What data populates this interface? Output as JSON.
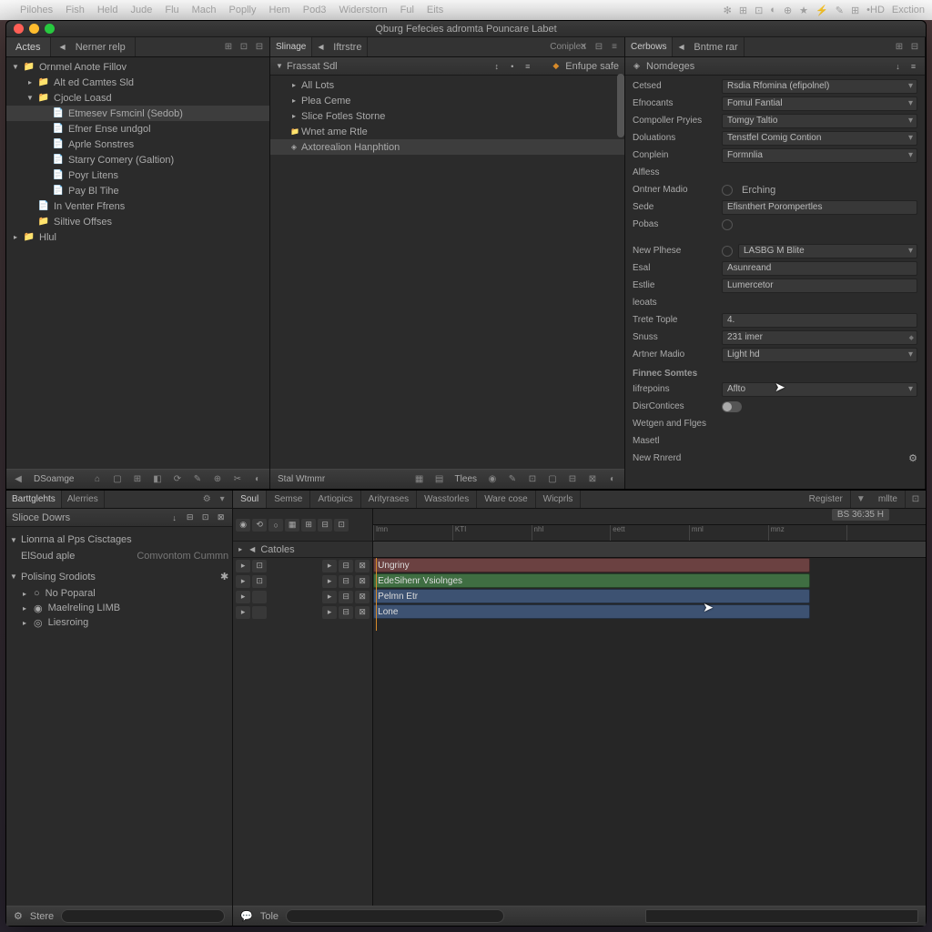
{
  "menubar": {
    "items": [
      "Pilohes",
      "Fish",
      "Held",
      "Jude",
      "Flu",
      "Mach",
      "Poplly",
      "Hem",
      "Pod3",
      "Widerstorn",
      "Ful",
      "Eits"
    ],
    "right": [
      "✻",
      "⊞",
      "⊡",
      "◐",
      "⊕",
      "★",
      "⚡",
      "✎",
      "⊞",
      "•HD",
      "Exction"
    ]
  },
  "window": {
    "title": "Qburg Fefecies adromta Pouncare Labet"
  },
  "left_tabs": [
    "Actes",
    "Nerner relp"
  ],
  "left_tab_icons": [
    "⊞",
    "⊡",
    "⊟"
  ],
  "mid_tabs": [
    "Slinage",
    "Iftrstre"
  ],
  "mid_head_label": "Enfupe safe",
  "right_tabs": [
    "Cerbows",
    "Bntme rar"
  ],
  "right_tab_icons": [
    "⊞",
    "⊟"
  ],
  "project_tree": [
    {
      "lvl": 0,
      "icon": "📁",
      "label": "Ornmel Anote Fillov",
      "open": true
    },
    {
      "lvl": 1,
      "icon": "📁",
      "label": "Alt ed Camtes Sld",
      "open": false
    },
    {
      "lvl": 1,
      "icon": "📁",
      "label": "Cjocle Loasd",
      "open": true
    },
    {
      "lvl": 2,
      "icon": "📄",
      "label": "Etmesev Fsmcinl (Sedob)",
      "sel": true
    },
    {
      "lvl": 2,
      "icon": "📄",
      "label": "Efner Ense undgol"
    },
    {
      "lvl": 2,
      "icon": "📄",
      "label": "Aprle Sonstres"
    },
    {
      "lvl": 2,
      "icon": "📄",
      "label": "Starry Comery (Galtion)"
    },
    {
      "lvl": 2,
      "icon": "📄",
      "label": "Poyr Litens"
    },
    {
      "lvl": 2,
      "icon": "📄",
      "label": "Pay Bl Tihe"
    },
    {
      "lvl": 1,
      "icon": "📄",
      "label": "In Venter Ffrens"
    },
    {
      "lvl": 1,
      "icon": "📁",
      "label": "Siltive Offses"
    },
    {
      "lvl": 0,
      "icon": "📁",
      "label": "Hlul",
      "open": false
    }
  ],
  "mid_panel": {
    "head": "Frassat Sdl",
    "rows": [
      {
        "icon": "▸",
        "label": "All Lots"
      },
      {
        "icon": "▸",
        "label": "Plea Ceme"
      },
      {
        "icon": "▸",
        "label": "Slice Fotles Storne"
      },
      {
        "icon": "📁",
        "label": "Wnet ame Rtle"
      },
      {
        "icon": "◈",
        "label": "Axtorealion Hanphtion",
        "sel": true
      }
    ]
  },
  "props_panel": {
    "head": "Nomdeges",
    "rows": [
      {
        "lbl": "Cetsed",
        "val": "Rsdia Rfomina (efipolnel)",
        "type": "dd"
      },
      {
        "lbl": "Efnocants",
        "val": "Fomul Fantial",
        "type": "dd"
      },
      {
        "lbl": "Compoller Pryies",
        "val": "Tomgy Taltio",
        "type": "dd"
      },
      {
        "lbl": "Doluations",
        "val": "Tenstfel Comig Contion",
        "type": "dd"
      },
      {
        "lbl": "Conplein",
        "val": "Formnlia",
        "type": "dd"
      },
      {
        "lbl": "Alfless",
        "val": "",
        "type": "none"
      },
      {
        "lbl": "Ontner Madio",
        "val": "Erching",
        "type": "radio"
      },
      {
        "lbl": "Sede",
        "val": "Efisnthert Porompertles",
        "type": "txt"
      },
      {
        "lbl": "Pobas",
        "val": "",
        "type": "radonly"
      }
    ],
    "rows2": [
      {
        "lbl": "New Plhese",
        "val": "LASBG M Blite",
        "type": "dd",
        "radio": true
      },
      {
        "lbl": "Esal",
        "val": "Asunreand",
        "type": "txt"
      },
      {
        "lbl": "Estlie",
        "val": "Lumercetor",
        "type": "txt"
      },
      {
        "lbl": "leoats",
        "val": "",
        "type": "none"
      },
      {
        "lbl": "Trete Tople",
        "val": "4.",
        "type": "txt"
      },
      {
        "lbl": "Snuss",
        "val": "231 imer",
        "type": "num"
      },
      {
        "lbl": "Artner Madio",
        "val": "Light hd",
        "type": "dd"
      }
    ],
    "sect3": "Finnec Somtes",
    "rows3": [
      {
        "lbl": "Iifrepoins",
        "val": "Aflto",
        "type": "dd"
      },
      {
        "lbl": "DisrContices",
        "val": "",
        "type": "toggle"
      },
      {
        "lbl": "Wetgen and Flges",
        "val": "",
        "type": "none"
      },
      {
        "lbl": "Masetl",
        "val": "",
        "type": "none"
      },
      {
        "lbl": "New Rnrerd",
        "val": "",
        "type": "gear"
      }
    ]
  },
  "left_toolbar": {
    "label": "DSoamge",
    "icons": [
      "⌂",
      "▢",
      "⊞",
      "◧",
      "⟳",
      "✎",
      "⊕",
      "✂",
      "◐"
    ]
  },
  "mid_toolbar": {
    "label": "Stal Wtmmr",
    "icons": [
      "▦",
      "▤",
      "Tlees",
      "◉",
      "✎",
      "⊡",
      "▢",
      "⊟",
      "⊠",
      "◐"
    ]
  },
  "lower_left": {
    "tabs": [
      "Barttglehts",
      "Alerries"
    ],
    "slice": "Slioce Dowrs",
    "sect1": "Lionrna al Pps Cisctages",
    "sub1": "ElSoud aple",
    "sub1v": "Comvontom Cummn",
    "sect2": "Polising Srodiots",
    "items": [
      {
        "icon": "○",
        "label": "No Poparal"
      },
      {
        "icon": "◉",
        "label": "Maelreling LIMB"
      },
      {
        "icon": "◎",
        "label": "Liesroing"
      }
    ],
    "footer": "Stere"
  },
  "timeline": {
    "tabs": [
      "Soul",
      "Semse",
      "Artiopics",
      "Arityrases",
      "Wasstorles",
      "Ware cose",
      "Wicprls"
    ],
    "right_tabs": [
      "Register",
      "mllte"
    ],
    "timecode": "BS 36:35 H",
    "ruler": [
      "lmn",
      "KTI",
      "nhl",
      "eett",
      "mnl",
      "mnz"
    ],
    "header": "Catoles",
    "tracks": [
      {
        "name": "Ungriny",
        "color": "red"
      },
      {
        "name": "EdeSihenr Vsiolnges",
        "color": "green"
      },
      {
        "name": "Pelmn Etr",
        "color": "blue1"
      },
      {
        "name": "Lone",
        "color": "blue2"
      }
    ],
    "footer": "Tole"
  }
}
